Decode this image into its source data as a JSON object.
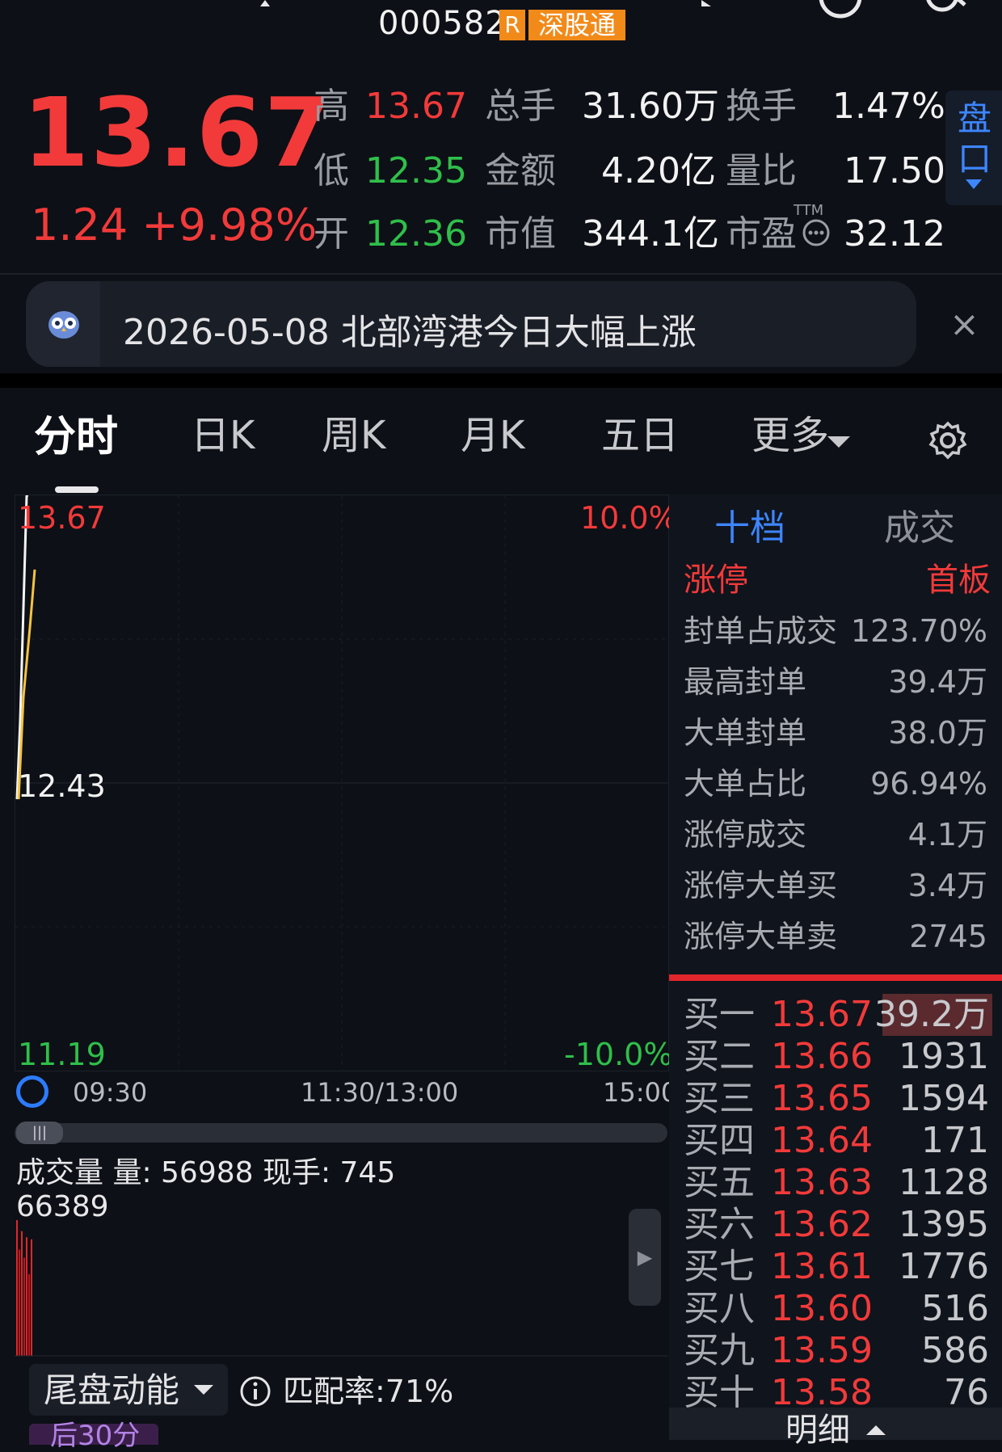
{
  "header": {
    "code": "000582",
    "badge_r": "R",
    "badge_sgt": "深股通"
  },
  "quote": {
    "price": "13.67",
    "change": "1.24 +9.98%",
    "high_label": "高",
    "high": "13.67",
    "low_label": "低",
    "low": "12.35",
    "open_label": "开",
    "open": "12.36",
    "volume_label": "总手",
    "volume": "31.60万",
    "amount_label": "金额",
    "amount": "4.20亿",
    "mktcap_label": "市值",
    "mktcap": "344.1亿",
    "turnover_label": "换手",
    "turnover": "1.47%",
    "volratio_label": "量比",
    "volratio": "17.50",
    "pe_label": "市盈",
    "pe_sup": "TTM",
    "pe": "32.12",
    "pankou_label": "盘口"
  },
  "news": {
    "text": "2026-05-08 北部湾港今日大幅上涨",
    "close": "×"
  },
  "tabs": [
    "分时",
    "日K",
    "周K",
    "月K",
    "五日",
    "更多"
  ],
  "chart": {
    "top_price": "13.67",
    "mid_price": "12.43",
    "bottom_price": "11.19",
    "top_pct": "10.0%",
    "bottom_pct": "-10.0%",
    "time_open": "09:30",
    "time_mid": "11:30/13:00",
    "time_close": "15:00",
    "volume_title": "成交量 量: 56988  现手: 745",
    "volume_max": "66389"
  },
  "chart_data": {
    "type": "line",
    "title": "",
    "y_range": [
      11.19,
      13.67
    ],
    "pct_range": [
      -10.0,
      10.0
    ],
    "prev_close": 12.43,
    "x_range": [
      "09:30",
      "15:00"
    ],
    "series": [
      {
        "values": [
          12.36,
          12.7,
          13.67,
          13.67
        ]
      },
      {
        "values": [
          12.36,
          12.8,
          13.1,
          13.35
        ]
      }
    ],
    "volume_bars": [
      66389,
      52000,
      61000,
      48000,
      58000,
      40000,
      56988
    ]
  },
  "bottom": {
    "dropdown": "尾盘动能",
    "match_rate": "匹配率:71%",
    "after30": "后30分"
  },
  "panel": {
    "tab_active": "十档",
    "tab_other": "成交",
    "limit_label": "涨停",
    "limit_tag": "首板",
    "stats": [
      {
        "label": "封单占成交",
        "value": "123.70%"
      },
      {
        "label": "最高封单",
        "value": "39.4万"
      },
      {
        "label": "大单封单",
        "value": "38.0万"
      },
      {
        "label": "大单占比",
        "value": "96.94%"
      },
      {
        "label": "涨停成交",
        "value": "4.1万"
      },
      {
        "label": "涨停大单买",
        "value": "3.4万"
      },
      {
        "label": "涨停大单卖",
        "value": "2745"
      }
    ],
    "bids": [
      {
        "label": "买一",
        "price": "13.67",
        "vol": "39.2万"
      },
      {
        "label": "买二",
        "price": "13.66",
        "vol": "1931"
      },
      {
        "label": "买三",
        "price": "13.65",
        "vol": "1594"
      },
      {
        "label": "买四",
        "price": "13.64",
        "vol": "171"
      },
      {
        "label": "买五",
        "price": "13.63",
        "vol": "1128"
      },
      {
        "label": "买六",
        "price": "13.62",
        "vol": "1395"
      },
      {
        "label": "买七",
        "price": "13.61",
        "vol": "1776"
      },
      {
        "label": "买八",
        "price": "13.60",
        "vol": "516"
      },
      {
        "label": "买九",
        "price": "13.59",
        "vol": "586"
      },
      {
        "label": "买十",
        "price": "13.58",
        "vol": "76"
      }
    ],
    "detail": "明细"
  },
  "colors": {
    "up": "#f23a3a",
    "down": "#2fbf4a",
    "accent": "#3d86ff",
    "badge": "#f28a1a"
  }
}
